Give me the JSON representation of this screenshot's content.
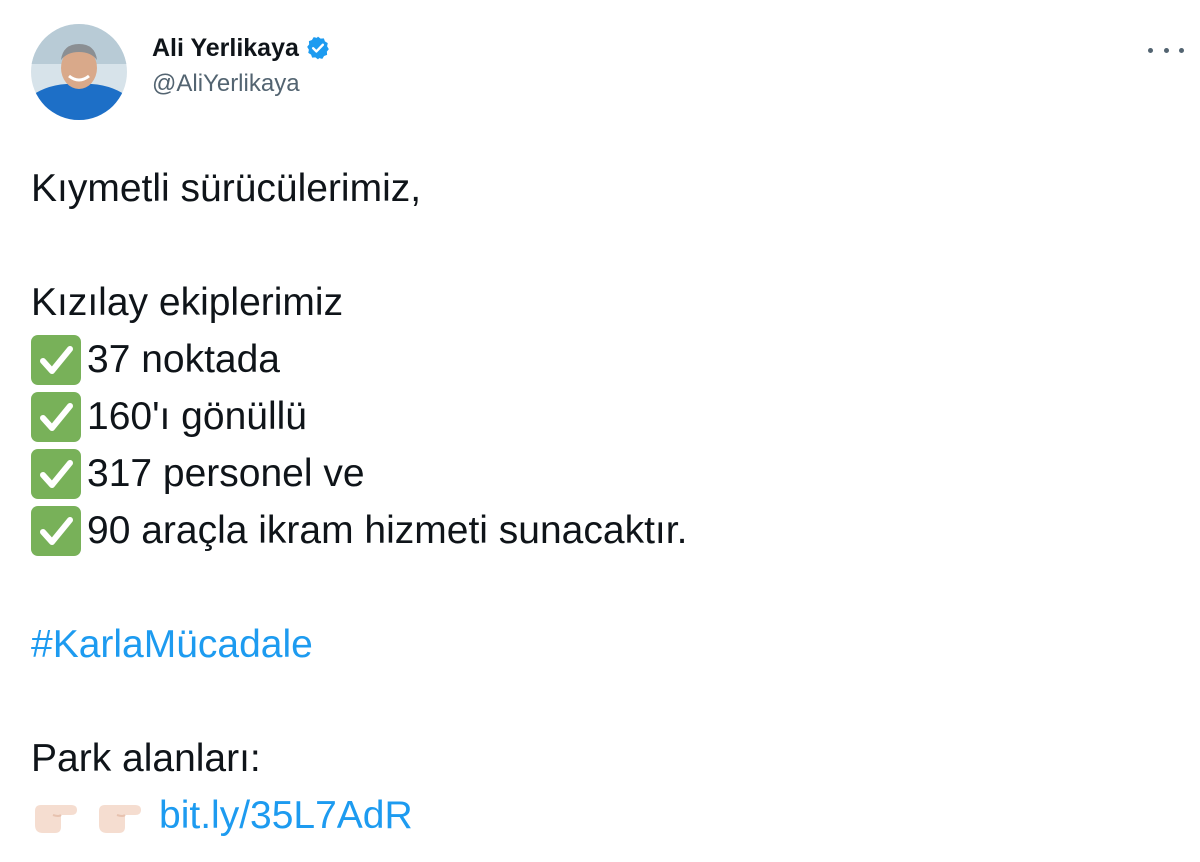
{
  "author": {
    "display_name": "Ali Yerlikaya",
    "handle": "@AliYerlikaya",
    "verified": true,
    "avatar_icon": "profile-photo"
  },
  "menu": {
    "icon": "more-options-icon"
  },
  "tweet": {
    "greeting": "Kıymetli sürücülerimiz,",
    "intro": "Kızılay ekiplerimiz",
    "checklist": [
      "37 noktada",
      "160'ı gönüllü",
      "317 personel ve",
      "90 araçla ikram hizmeti sunacaktır."
    ],
    "hashtag": "#KarlaMücadale",
    "parking_label": "Park alanları:",
    "link": "bit.ly/35L7AdR"
  },
  "colors": {
    "link_blue": "#1d9bf0",
    "check_green": "#78b159",
    "verified_blue": "#1d9bf0"
  }
}
